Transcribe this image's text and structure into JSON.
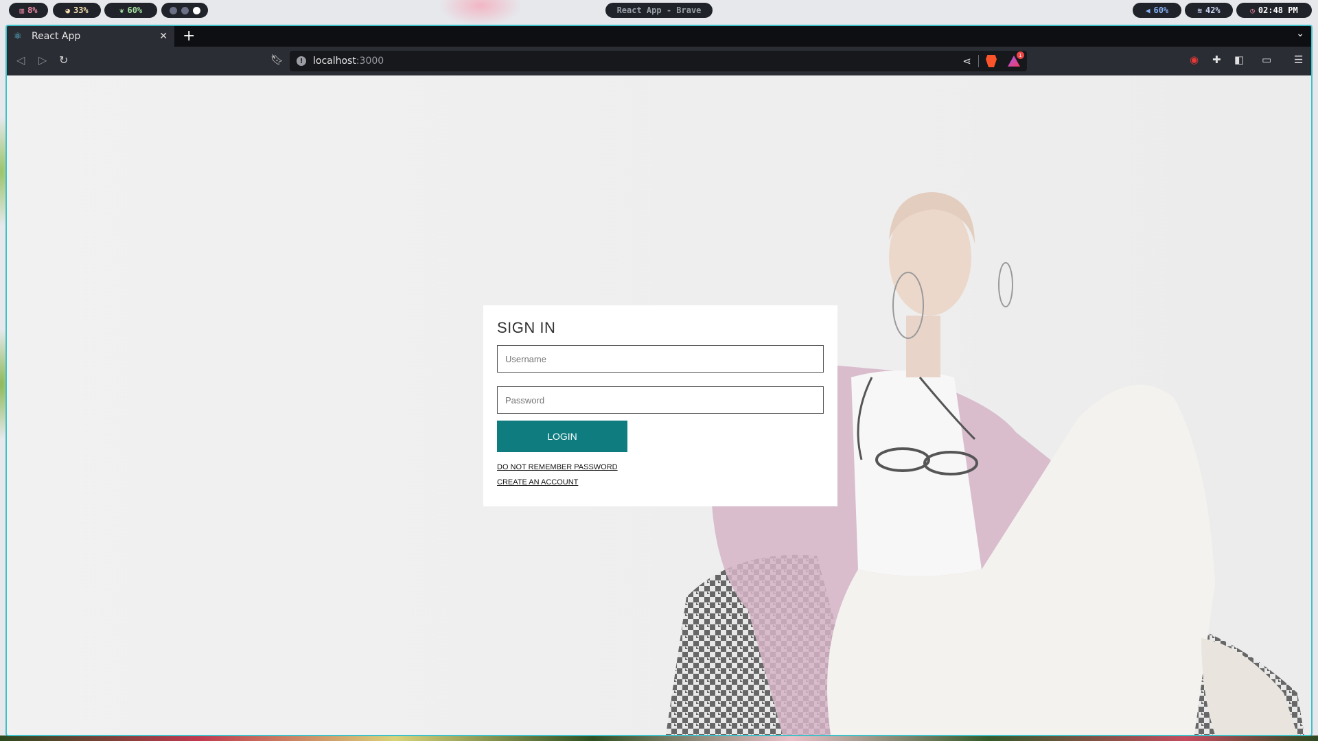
{
  "status_bar": {
    "cpu": "8%",
    "ram": "33%",
    "battery": "60%",
    "window_title": "React App - Brave",
    "volume": "60%",
    "wifi": "42%",
    "clock": "02:48 PM",
    "workspaces": [
      false,
      false,
      true
    ]
  },
  "browser": {
    "tab_title": "React App",
    "close_label": "✕",
    "new_tab_label": "+",
    "url_host": "localhost",
    "url_port": ":3000",
    "rewards_badge": "1"
  },
  "page": {
    "heading": "SIGN IN",
    "username_placeholder": "Username",
    "password_placeholder": "Password",
    "login_label": "LOGIN",
    "forgot_link": "DO NOT REMEMBER PASSWORD",
    "create_link": "CREATE AN ACCOUNT"
  },
  "colors": {
    "accent": "#0f7d80",
    "window_border": "#3fc1c9"
  }
}
